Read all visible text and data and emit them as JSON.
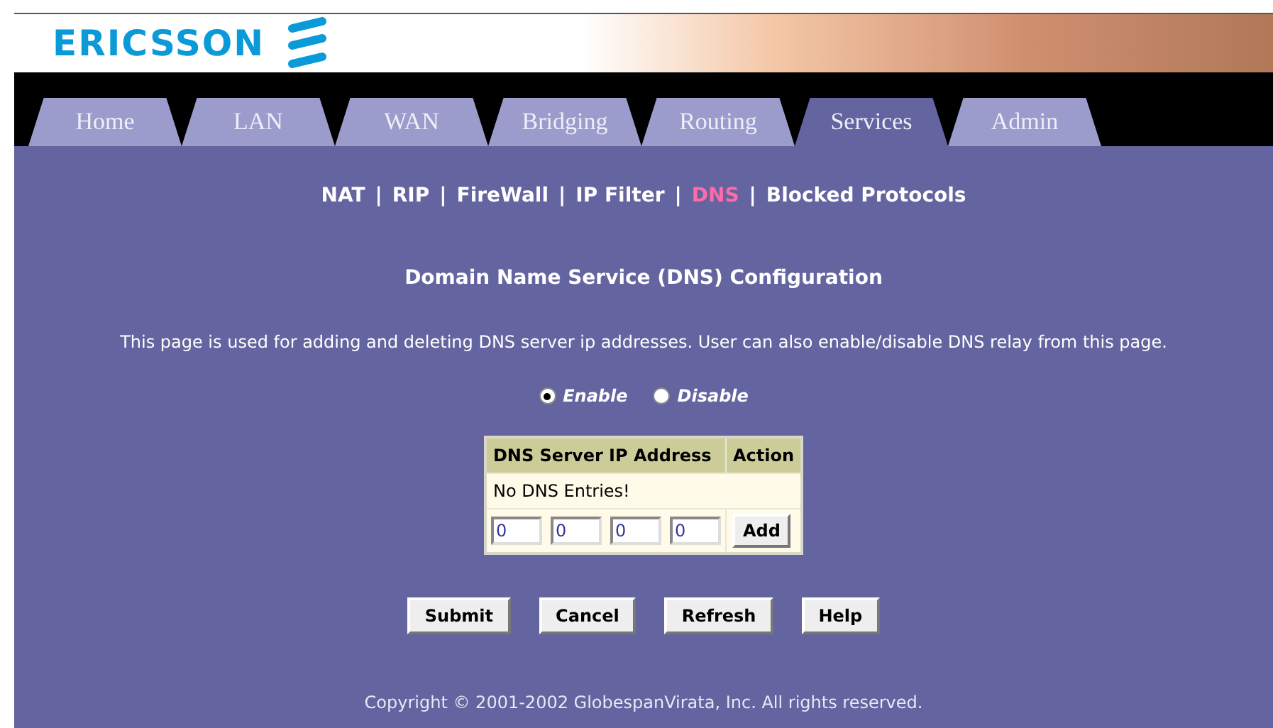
{
  "logo": {
    "text": "ERICSSON"
  },
  "tabs": [
    {
      "label": "Home",
      "selected": false
    },
    {
      "label": "LAN",
      "selected": false
    },
    {
      "label": "WAN",
      "selected": false
    },
    {
      "label": "Bridging",
      "selected": false
    },
    {
      "label": "Routing",
      "selected": false
    },
    {
      "label": "Services",
      "selected": true
    },
    {
      "label": "Admin",
      "selected": false
    }
  ],
  "subnav": [
    {
      "label": "NAT",
      "selected": false
    },
    {
      "label": "RIP",
      "selected": false
    },
    {
      "label": "FireWall",
      "selected": false
    },
    {
      "label": "IP Filter",
      "selected": false
    },
    {
      "label": "DNS",
      "selected": true
    },
    {
      "label": "Blocked Protocols",
      "selected": false
    }
  ],
  "separator": "|",
  "heading": "Domain Name Service (DNS) Configuration",
  "description": "This page is used for adding and deleting DNS server ip addresses. User can also enable/disable DNS relay from this page.",
  "relay": [
    {
      "label": "Enable",
      "selected": true
    },
    {
      "label": "Disable",
      "selected": false
    }
  ],
  "table": {
    "columns": [
      "DNS Server IP Address",
      "Action"
    ],
    "empty_message": "No DNS Entries!",
    "octets": [
      "0",
      "0",
      "0",
      "0"
    ],
    "add_button": "Add"
  },
  "buttons": [
    "Submit",
    "Cancel",
    "Refresh",
    "Help"
  ],
  "footer": "Copyright © 2001-2002 GlobespanVirata, Inc. All rights reserved."
}
